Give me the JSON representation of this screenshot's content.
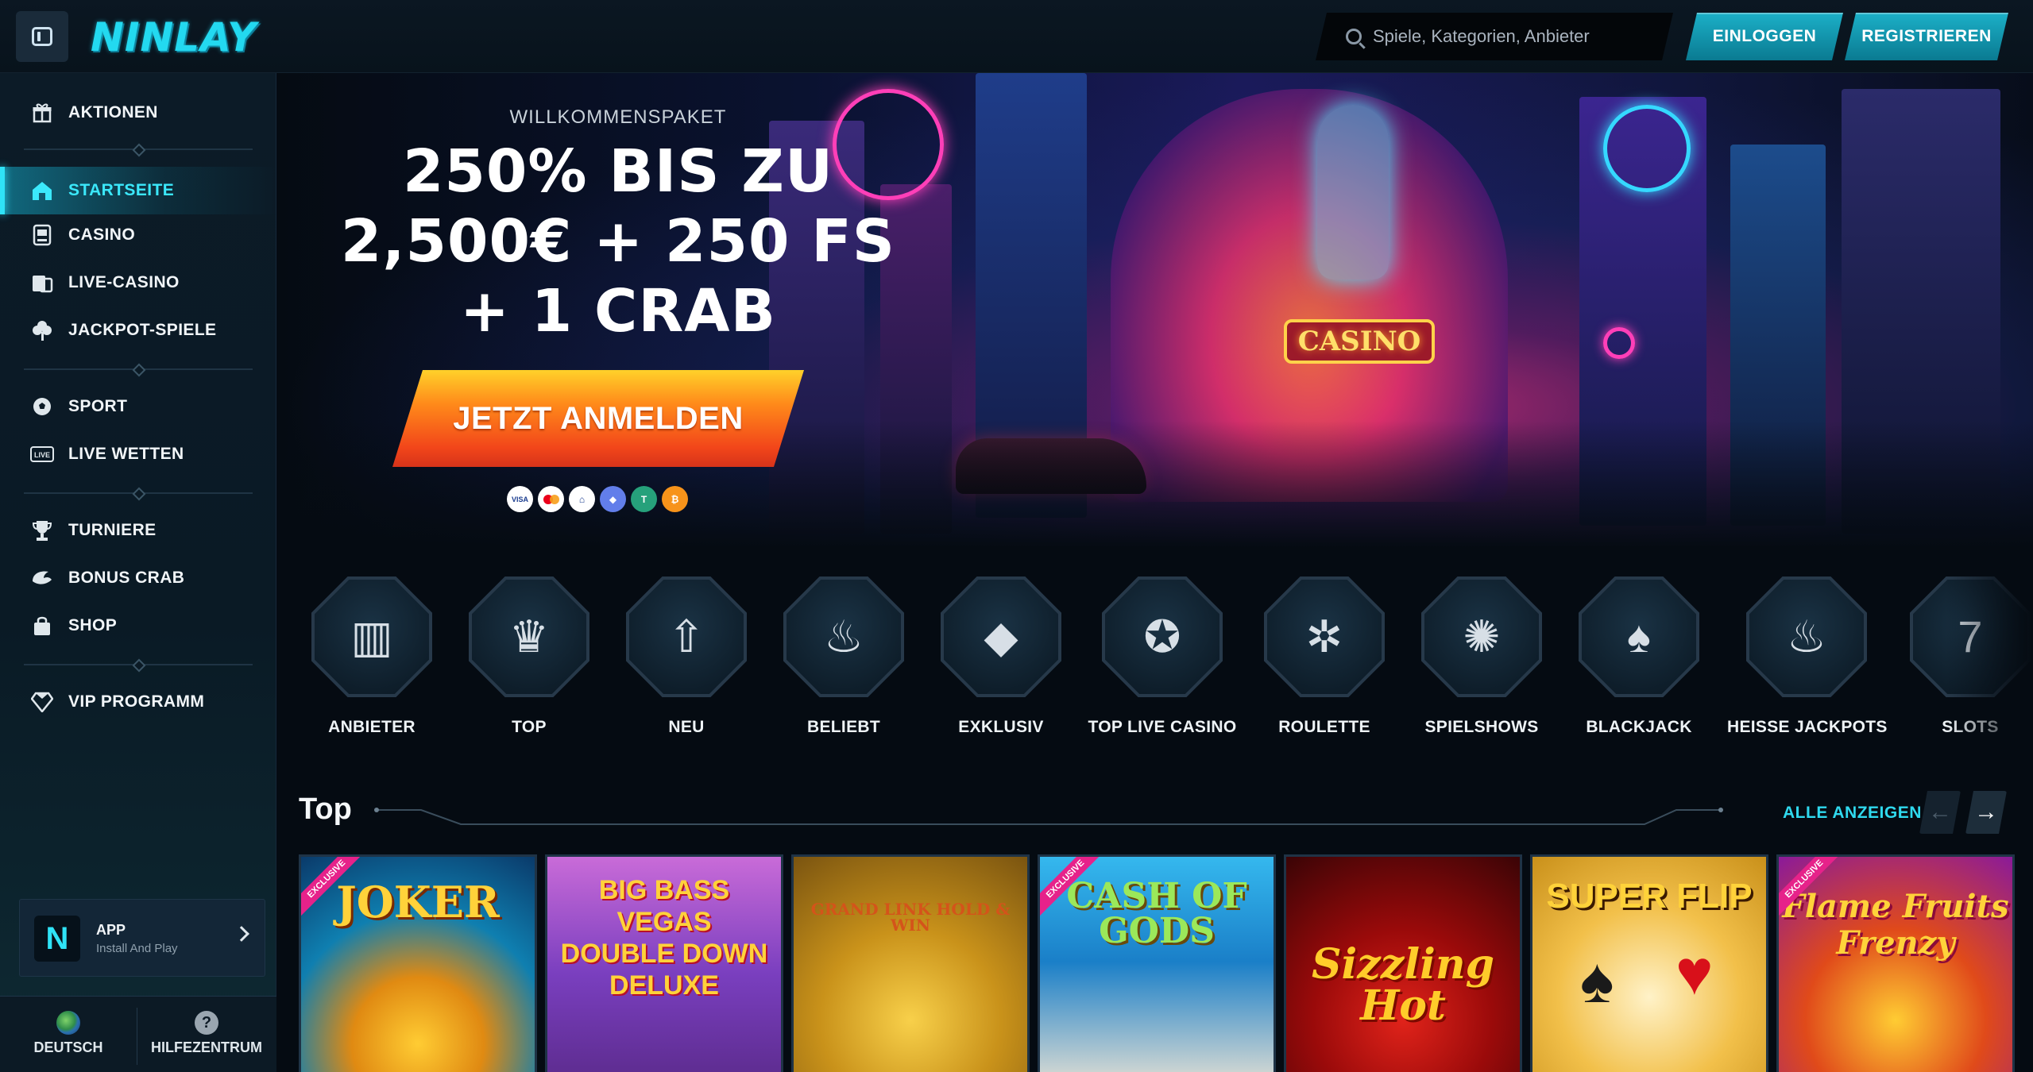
{
  "header": {
    "logo": "NINLAY",
    "search_placeholder": "Spiele, Kategorien, Anbieter",
    "login_label": "EINLOGGEN",
    "register_label": "REGISTRIEREN"
  },
  "sidebar": {
    "items": [
      {
        "label": "AKTIONEN",
        "icon": "gift-icon"
      },
      {
        "label": "STARTSEITE",
        "icon": "home-icon",
        "active": true
      },
      {
        "label": "CASINO",
        "icon": "slot-machine-icon"
      },
      {
        "label": "LIVE-CASINO",
        "icon": "live-dealer-icon"
      },
      {
        "label": "JACKPOT-SPIELE",
        "icon": "clover-icon"
      },
      {
        "label": "SPORT",
        "icon": "soccer-ball-icon"
      },
      {
        "label": "LIVE WETTEN",
        "icon": "live-badge-icon"
      },
      {
        "label": "TURNIERE",
        "icon": "trophy-icon"
      },
      {
        "label": "BONUS CRAB",
        "icon": "claw-icon"
      },
      {
        "label": "SHOP",
        "icon": "shopping-bag-icon"
      },
      {
        "label": "VIP PROGRAMM",
        "icon": "diamond-icon"
      }
    ],
    "app": {
      "title": "APP",
      "subtitle": "Install And Play",
      "logo_letter": "N"
    },
    "bottom": [
      {
        "label": "DEUTSCH",
        "icon": "globe-icon"
      },
      {
        "label": "HILFEZENTRUM",
        "icon": "help-icon"
      }
    ]
  },
  "hero": {
    "kicker": "WILLKOMMENSPAKET",
    "title_line1": "250% BIS ZU",
    "title_line2": "2,500€ + 250 FS",
    "title_line3": "+ 1 CRAB",
    "cta_label": "JETZT ANMELDEN",
    "casino_sign": "CASINO",
    "payments": [
      "VISA",
      "mastercard",
      "bank",
      "ethereum",
      "tether",
      "bitcoin"
    ]
  },
  "categories": [
    {
      "label": "ANBIETER",
      "icon": "book-icon",
      "glyph": "▥"
    },
    {
      "label": "TOP",
      "icon": "crown-icon",
      "glyph": "♛"
    },
    {
      "label": "NEU",
      "icon": "rocket-icon",
      "glyph": "⇧"
    },
    {
      "label": "BELIEBT",
      "icon": "flame-icon",
      "glyph": "♨"
    },
    {
      "label": "EXKLUSIV",
      "icon": "diamond-icon",
      "glyph": "◆"
    },
    {
      "label": "TOP LIVE CASINO",
      "icon": "award-ribbon-icon",
      "glyph": "✪"
    },
    {
      "label": "ROULETTE",
      "icon": "roulette-wheel-icon",
      "glyph": "✲"
    },
    {
      "label": "SPIELSHOWS",
      "icon": "wheel-of-fortune-icon",
      "glyph": "✺"
    },
    {
      "label": "BLACKJACK",
      "icon": "playing-cards-icon",
      "glyph": "♠"
    },
    {
      "label": "HEISSE JACKPOTS",
      "icon": "fire-pot-icon",
      "glyph": "♨"
    },
    {
      "label": "SLOTS",
      "icon": "slot-reels-icon",
      "glyph": "7"
    }
  ],
  "top_section": {
    "title": "Top",
    "see_all": "ALLE ANZEIGEN",
    "games": [
      {
        "title": "JOKER",
        "exclusive": true
      },
      {
        "title": "BIG BASS VEGAS DOUBLE DOWN DELUXE",
        "exclusive": false
      },
      {
        "title": "GRAND LINK HOLD & WIN",
        "exclusive": false
      },
      {
        "title": "CASH OF GODS",
        "exclusive": true
      },
      {
        "title": "Sizzling Hot",
        "exclusive": false
      },
      {
        "title": "SUPER FLIP",
        "exclusive": false
      },
      {
        "title": "Flame Fruits Frenzy",
        "exclusive": true
      }
    ],
    "exclusive_label": "EXCLUSIVE"
  },
  "colors": {
    "accent": "#2fe3f7",
    "cta_orange": "#f2461a",
    "background": "#050b12",
    "sidebar_bg": "#0c1b27"
  }
}
